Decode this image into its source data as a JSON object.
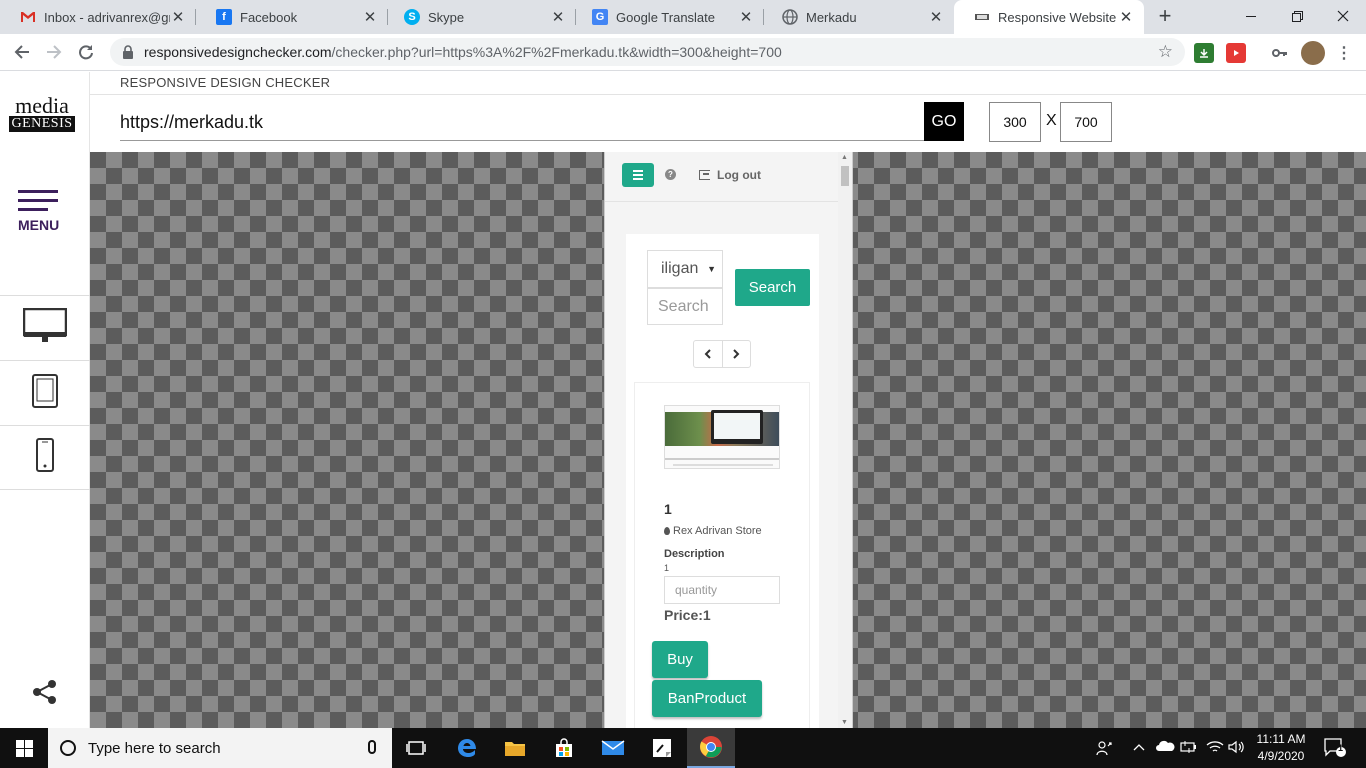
{
  "browser": {
    "tabs": [
      {
        "title": "Inbox - adrivanrex@gm",
        "favicon": "gmail-icon",
        "color": "#d93025"
      },
      {
        "title": "Facebook",
        "favicon": "facebook-icon",
        "color": "#1877f2"
      },
      {
        "title": "Skype",
        "favicon": "skype-icon",
        "color": "#00aff0"
      },
      {
        "title": "Google Translate",
        "favicon": "google-translate-icon",
        "color": "#4285f4"
      },
      {
        "title": "Merkadu",
        "favicon": "globe-icon",
        "color": "#5f6368"
      },
      {
        "title": "Responsive Website De",
        "favicon": "responsive-icon",
        "color": "#555555"
      }
    ],
    "url_host": "responsivedesignchecker.com",
    "url_path": "/checker.php?url=https%3A%2F%2Fmerkadu.tk&width=300&height=700"
  },
  "checker": {
    "header_title": "RESPONSIVE DESIGN CHECKER",
    "logo_top": "media",
    "logo_bottom": "GENESIS",
    "menu_label": "MENU",
    "url_value": "https://merkadu.tk",
    "go_label": "GO",
    "width": "300",
    "height": "700",
    "times": "X"
  },
  "site": {
    "logout_label": "Log out",
    "help_icon": "?",
    "location_value": "iligan",
    "search_placeholder": "Search",
    "search_button": "Search",
    "product": {
      "name": "1",
      "store": "Rex Adrivan Store",
      "description_label": "Description",
      "description": "1",
      "quantity_placeholder": "quantity",
      "price": "Price:1",
      "buy_label": "Buy",
      "ban_label": "BanProduct"
    },
    "accent_color": "#1fa88a"
  },
  "taskbar": {
    "search_placeholder": "Type here to search",
    "time": "11:11 AM",
    "date": "4/9/2020",
    "notification_count": "1"
  }
}
